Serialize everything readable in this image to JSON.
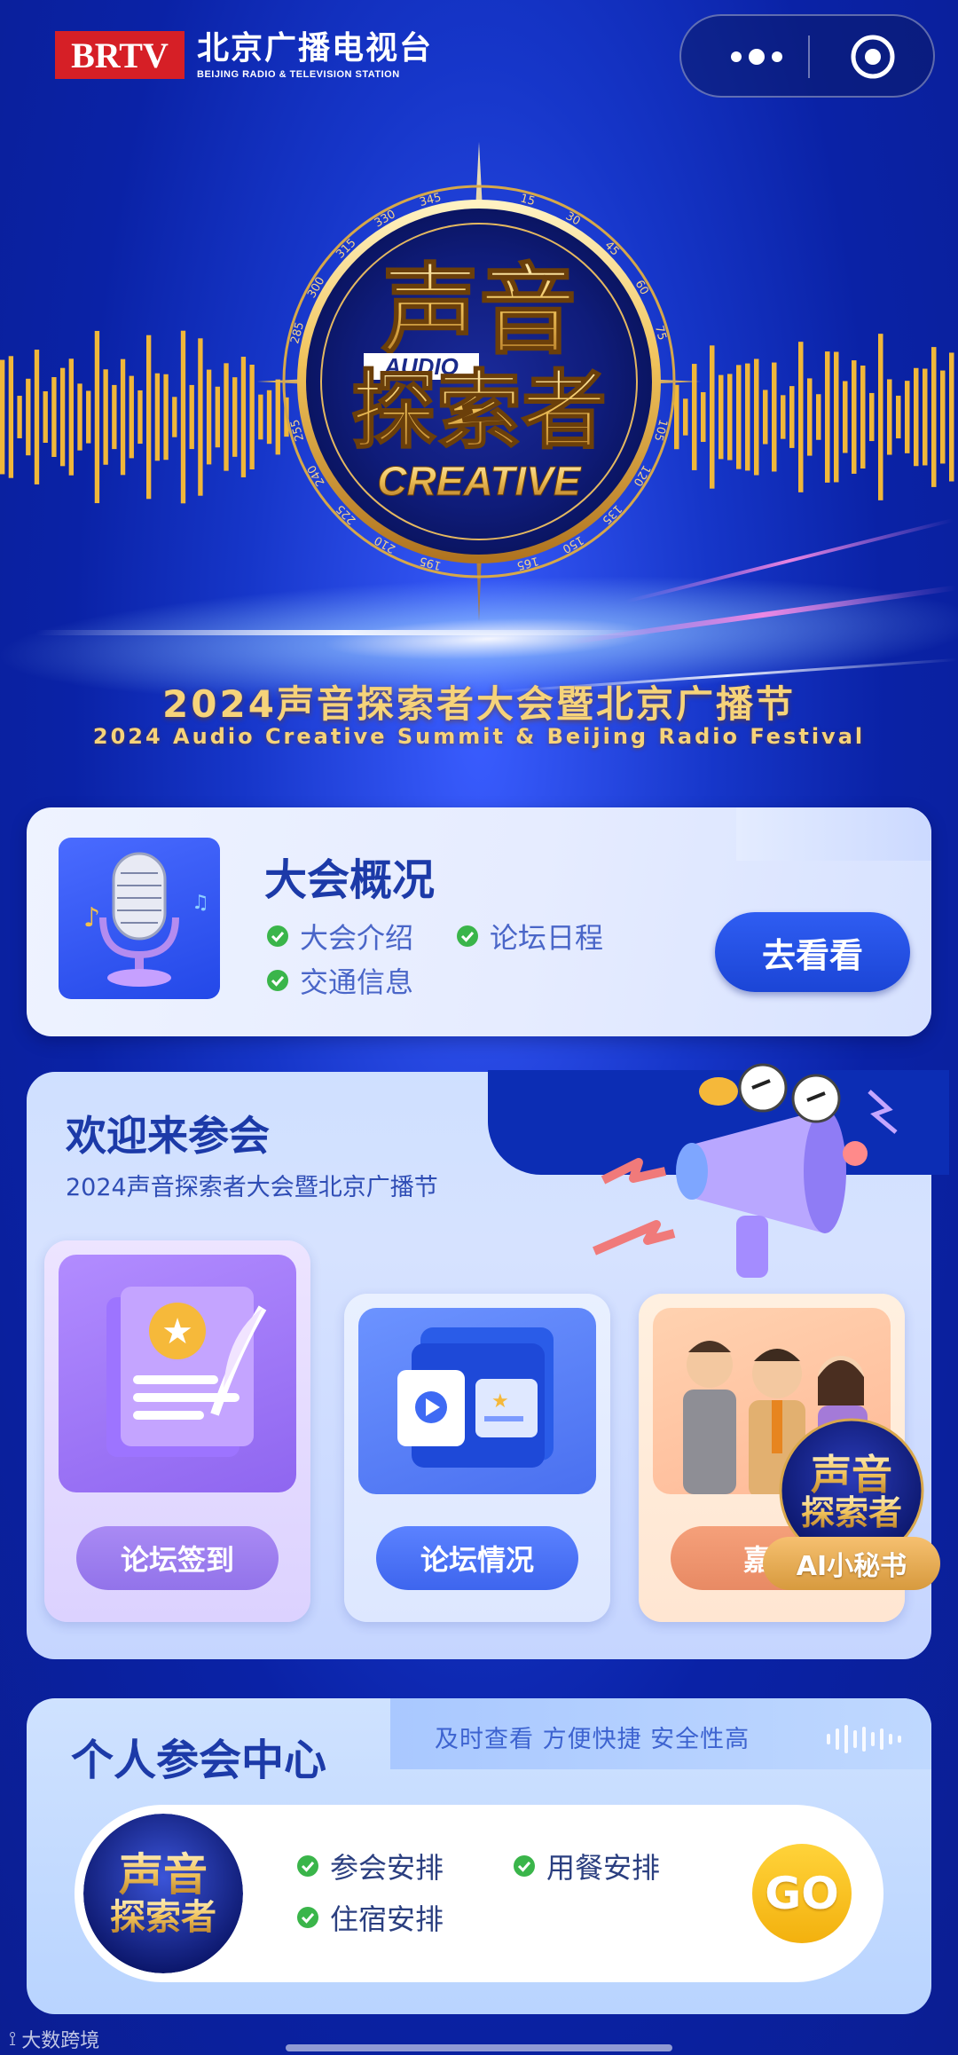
{
  "brand": {
    "logo": "BRTV",
    "name_cn": "北京广播电视台",
    "name_en": "BEIJING RADIO & TELEVISION STATION"
  },
  "capsule": {
    "more_icon": "more-dots-icon",
    "close_icon": "target-icon"
  },
  "hero": {
    "emblem_line1": "声音",
    "emblem_audio": "AUDIO",
    "emblem_line2": "探索者",
    "emblem_creative": "CREATIVE",
    "title": "2024声音探索者大会暨北京广播节",
    "subtitle": "2024 Audio Creative Summit & Beijing Radio Festival",
    "compass_marks": [
      "345",
      "15",
      "30",
      "45",
      "60",
      "75",
      "105",
      "120",
      "135",
      "150",
      "165",
      "195",
      "210",
      "225",
      "240",
      "255",
      "285",
      "300",
      "315",
      "330"
    ]
  },
  "overview": {
    "title": "大会概况",
    "items": [
      "大会介绍",
      "论坛日程",
      "交通信息"
    ],
    "button": "去看看",
    "icon": "microphone-icon"
  },
  "welcome": {
    "title": "欢迎来参会",
    "subtitle": "2024声音探索者大会暨北京广播节",
    "tiles": [
      {
        "label": "论坛签到",
        "icon": "sign-in-book-icon"
      },
      {
        "label": "论坛情况",
        "icon": "folder-video-icon"
      },
      {
        "label": "嘉宾",
        "icon": "guests-people-icon"
      }
    ],
    "ai_assistant": "AI小秘书"
  },
  "personal": {
    "title": "个人参会中心",
    "tagline": "及时查看  方便快捷  安全性高",
    "items": [
      "参会安排",
      "用餐安排",
      "住宿安排"
    ],
    "go": "GO"
  },
  "watermark": "大数跨境",
  "colors": {
    "primary_blue": "#1b45d6",
    "title_blue": "#1c3aa8",
    "gold": "#f6d37a",
    "check_green": "#3ab54a",
    "go_yellow": "#f3b10e",
    "brand_red": "#d61f26"
  }
}
